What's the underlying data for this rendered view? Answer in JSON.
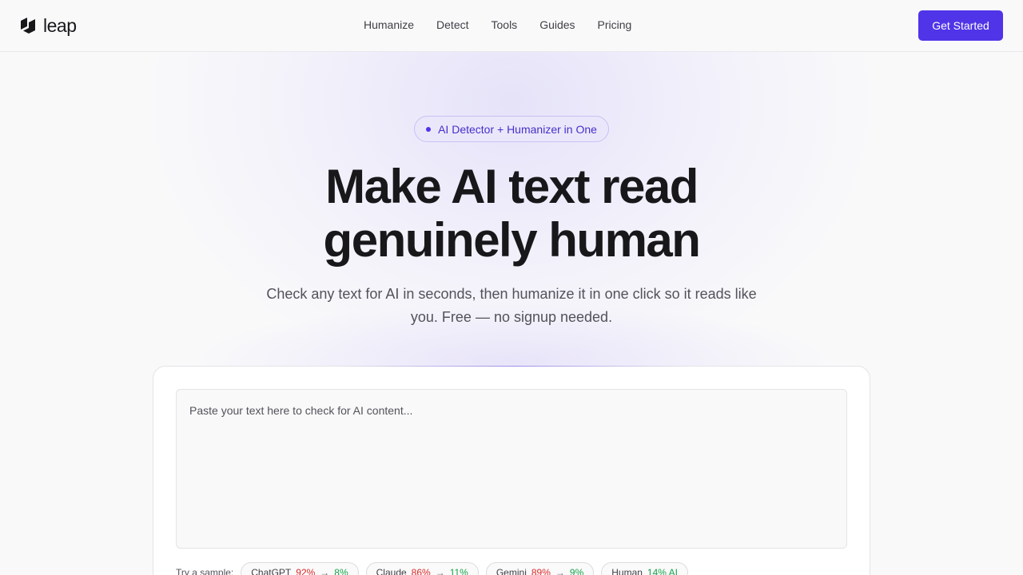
{
  "brand": {
    "name": "leap"
  },
  "nav": {
    "items": [
      {
        "label": "Humanize"
      },
      {
        "label": "Detect"
      },
      {
        "label": "Tools"
      },
      {
        "label": "Guides"
      },
      {
        "label": "Pricing"
      }
    ],
    "cta_label": "Get Started"
  },
  "hero": {
    "badge": "AI Detector + Humanizer in One",
    "headline_line1": "Make AI text read",
    "headline_line2": "genuinely human",
    "subtitle": "Check any text for AI in seconds, then humanize it in one click so it reads like you. Free — no signup needed."
  },
  "checker": {
    "placeholder": "Paste your text here to check for AI content...",
    "samples_label": "Try a sample:",
    "samples": [
      {
        "name": "ChatGPT",
        "from": "92%",
        "arrow": "→",
        "to": "8%"
      },
      {
        "name": "Claude",
        "from": "86%",
        "arrow": "→",
        "to": "11%"
      },
      {
        "name": "Gemini",
        "from": "89%",
        "arrow": "→",
        "to": "9%"
      },
      {
        "name": "Human",
        "to": "14% AI"
      }
    ]
  },
  "colors": {
    "accent": "#4f34e8",
    "ai_score": "#dc2626",
    "human_score": "#16a34a"
  }
}
